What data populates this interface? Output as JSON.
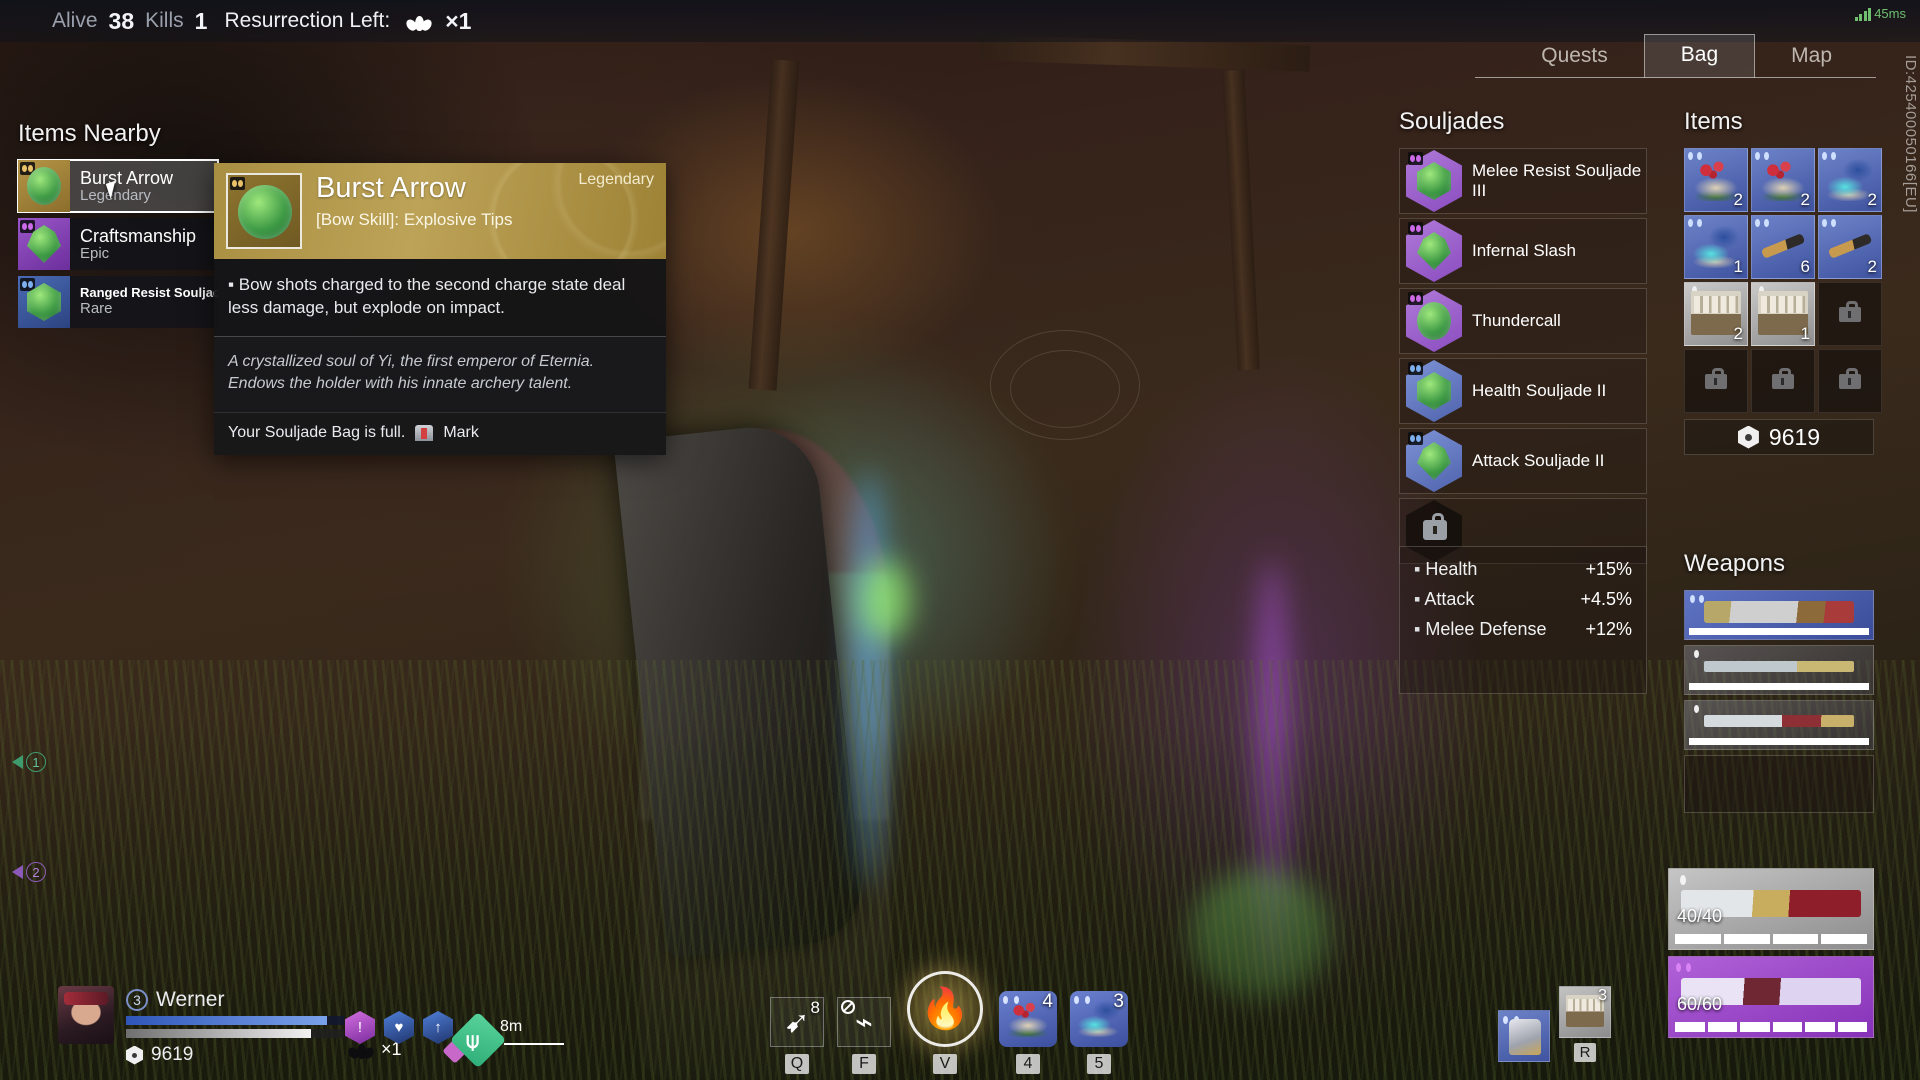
{
  "hud": {
    "alive_label": "Alive",
    "alive_value": "38",
    "kills_label": "Kills",
    "kills_value": "1",
    "resurrection_label": "Resurrection Left:",
    "resurrection_count": "×1",
    "ping": "45ms",
    "session_id": "ID:425400050166[EU]"
  },
  "tabs": [
    {
      "label": "Quests",
      "active": false
    },
    {
      "label": "Bag",
      "active": true
    },
    {
      "label": "Map",
      "active": false
    }
  ],
  "items_nearby": {
    "title": "Items Nearby",
    "rows": [
      {
        "name": "Burst Arrow",
        "rarity": "Legendary",
        "selected": true
      },
      {
        "name": "Craftsmanship",
        "rarity": "Epic",
        "selected": false
      },
      {
        "name": "Ranged Resist Souljade II",
        "rarity": "Rare",
        "selected": false
      }
    ]
  },
  "tooltip": {
    "rarity": "Legendary",
    "title": "Burst Arrow",
    "subtitle": "[Bow Skill]: Explosive Tips",
    "effect": "▪ Bow shots charged to the second charge state deal less damage, but explode on impact.",
    "lore": "A crystallized soul of Yi, the first emperor of Eternia. Endows the holder with his innate archery talent.",
    "warning": "Your Souljade Bag is full.",
    "mark_label": "Mark"
  },
  "souljades": {
    "title": "Souljades",
    "rows": [
      {
        "name": "Melee Resist Souljade III",
        "rarity": "epic"
      },
      {
        "name": "Infernal Slash",
        "rarity": "epic"
      },
      {
        "name": "Thundercall",
        "rarity": "epic"
      },
      {
        "name": "Health Souljade II",
        "rarity": "rare"
      },
      {
        "name": "Attack Souljade II",
        "rarity": "rare"
      },
      {
        "name": "",
        "rarity": "locked"
      }
    ],
    "stats": [
      {
        "name": "Health",
        "value": "+15%"
      },
      {
        "name": "Attack",
        "value": "+4.5%"
      },
      {
        "name": "Melee Defense",
        "value": "+12%"
      }
    ]
  },
  "items": {
    "title": "Items",
    "cells": [
      {
        "art": "berry",
        "qty": "2",
        "rarity": "rare"
      },
      {
        "art": "berry",
        "qty": "2",
        "rarity": "rare"
      },
      {
        "art": "powder",
        "qty": "2",
        "rarity": "rare"
      },
      {
        "art": "powder",
        "qty": "1",
        "rarity": "rare"
      },
      {
        "art": "rod",
        "qty": "6",
        "rarity": "rare"
      },
      {
        "art": "rod",
        "qty": "2",
        "rarity": "rare"
      },
      {
        "art": "crate",
        "qty": "2",
        "rarity": "common"
      },
      {
        "art": "crate",
        "qty": "1",
        "rarity": "common"
      },
      {
        "art": "locked",
        "qty": "",
        "rarity": "empty"
      },
      {
        "art": "locked",
        "qty": "",
        "rarity": "empty"
      },
      {
        "art": "locked",
        "qty": "",
        "rarity": "empty"
      },
      {
        "art": "locked",
        "qty": "",
        "rarity": "empty"
      }
    ],
    "currency": "9619"
  },
  "weapons": {
    "title": "Weapons",
    "slots": [
      {
        "art": "sword-a",
        "rarity": "rare",
        "empty": false
      },
      {
        "art": "sword-b",
        "rarity": "common",
        "empty": false
      },
      {
        "art": "sword-c",
        "rarity": "common",
        "empty": false
      },
      {
        "art": "",
        "rarity": "empty",
        "empty": true
      }
    ]
  },
  "ammo": [
    {
      "count": "40/40",
      "rarity": "grey",
      "segments": 4
    },
    {
      "count": "60/60",
      "rarity": "purple",
      "segments": 6
    }
  ],
  "player": {
    "team_number": "3",
    "name": "Werner",
    "currency": "9619",
    "resurrection": "×1"
  },
  "skills": [
    {
      "glyph": "➹",
      "key": "Q",
      "ammo": "8",
      "disabled": false
    },
    {
      "glyph": "⌁",
      "key": "F",
      "ammo": "",
      "disabled": true
    }
  ],
  "ultimate": {
    "key": "V",
    "glyph": "🔥"
  },
  "quick_items": [
    {
      "art": "berry",
      "qty": "4",
      "key": "4"
    },
    {
      "art": "powder",
      "qty": "3",
      "key": "5"
    }
  ],
  "right_slots": [
    {
      "art": "armor",
      "qty": "",
      "key": ""
    },
    {
      "art": "crate",
      "qty": "3",
      "key": "R"
    }
  ],
  "team_markers": [
    {
      "num": "1",
      "color": "#3e9b6d"
    },
    {
      "num": "2",
      "color": "#8b5ab8"
    }
  ],
  "compass": {
    "distance": "8m",
    "glyph": "⍦"
  }
}
